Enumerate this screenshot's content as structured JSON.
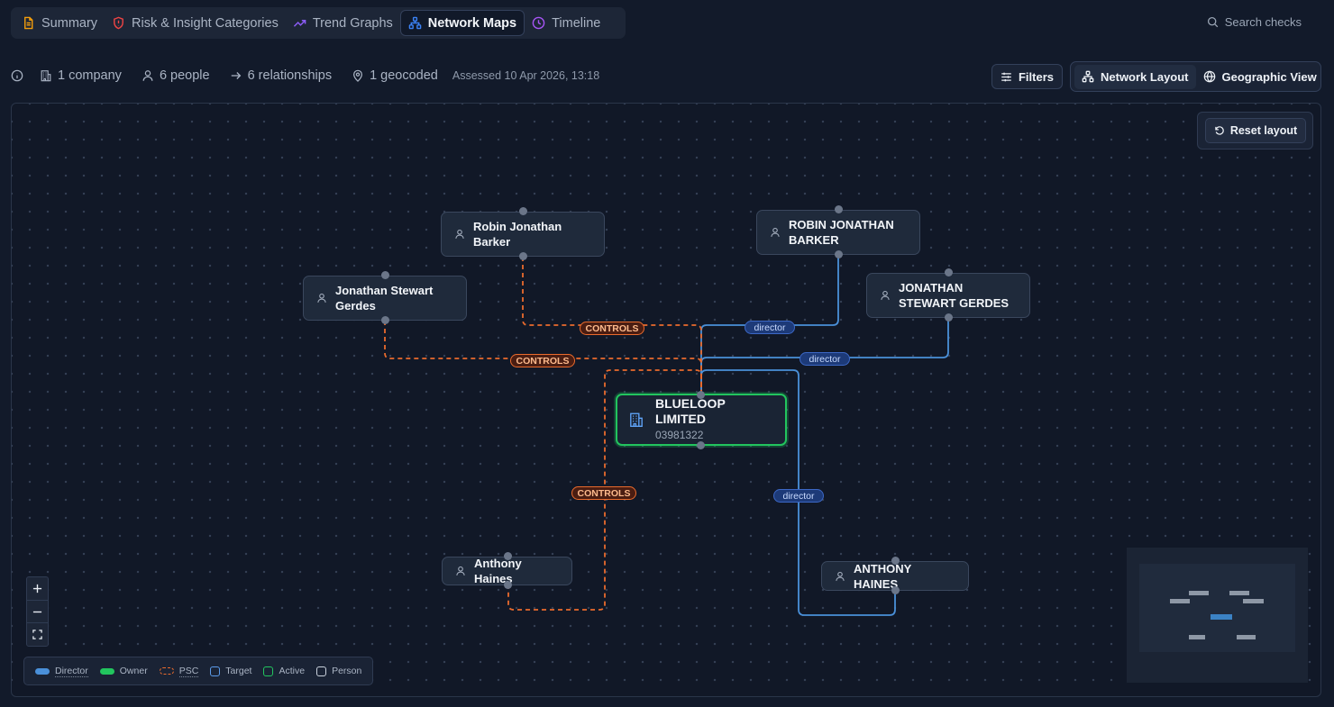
{
  "tabs": [
    {
      "label": "Summary",
      "icon": "document-icon",
      "color": "#f59e0b"
    },
    {
      "label": "Risk & Insight Categories",
      "icon": "shield-alert-icon",
      "color": "#ef4444"
    },
    {
      "label": "Trend Graphs",
      "icon": "trend-up-icon",
      "color": "#8b5cf6"
    },
    {
      "label": "Network Maps",
      "icon": "network-icon",
      "color": "#3b82f6",
      "active": true
    },
    {
      "label": "Timeline",
      "icon": "clock-icon",
      "color": "#a855f7"
    }
  ],
  "search": {
    "label": "Search checks"
  },
  "stats": {
    "company": "1 company",
    "people": "6 people",
    "relationships": "6 relationships",
    "geocoded": "1 geocoded",
    "assessed": "Assessed 10 Apr 2026, 13:18"
  },
  "toolbar": {
    "filters": "Filters",
    "network_layout": "Network Layout",
    "geographic_view": "Geographic View",
    "reset_layout": "Reset layout"
  },
  "nodes": {
    "company": {
      "name": "BLUELOOP LIMITED",
      "number": "03981322"
    },
    "p1": "Robin Jonathan Barker",
    "p2": "ROBIN JONATHAN BARKER",
    "p3": "Jonathan Stewart Gerdes",
    "p4": "JONATHAN STEWART GERDES",
    "p5": "Anthony Haines",
    "p6": "ANTHONY HAINES"
  },
  "edges": {
    "psc_label": "CONTROLS",
    "director_label": "director"
  },
  "legend": {
    "director": "Director",
    "owner": "Owner",
    "psc": "PSC",
    "target": "Target",
    "active": "Active",
    "person": "Person"
  },
  "colors": {
    "director": "#4a90d9",
    "owner": "#22c55e",
    "psc": "#ea6b2d",
    "target": "#5b9bea",
    "active": "#22c55e",
    "person": "#c9d1dc"
  }
}
